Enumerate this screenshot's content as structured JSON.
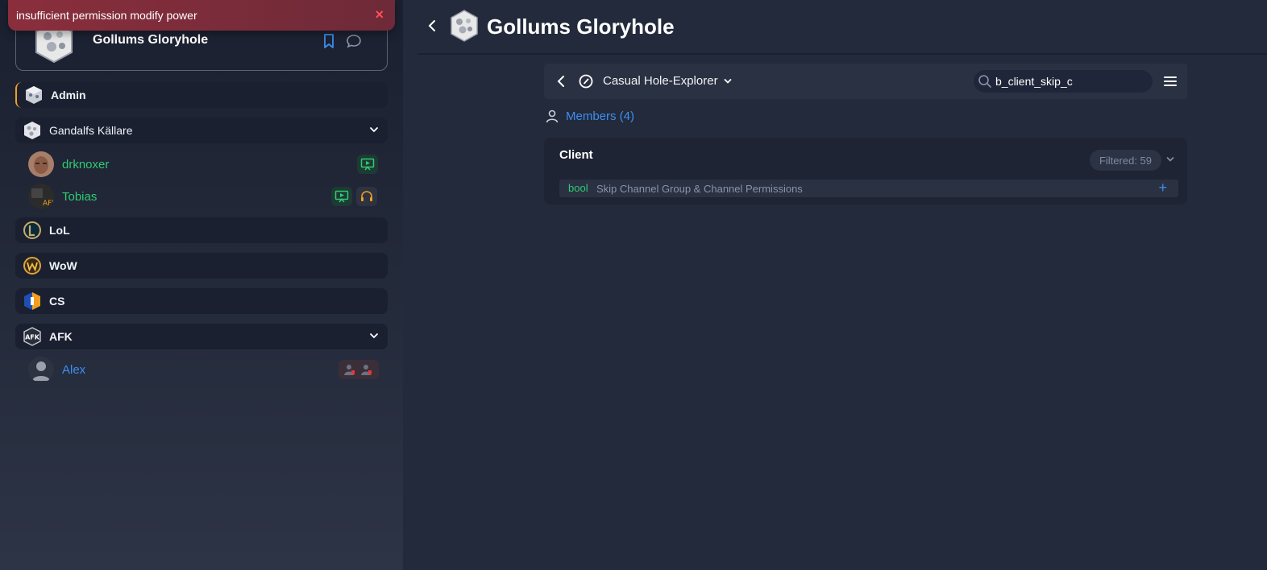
{
  "toast": {
    "message": "insufficient permission modify power",
    "close": "×"
  },
  "server": {
    "name": "Gollums Gloryhole"
  },
  "channels": [
    {
      "label": "Admin"
    },
    {
      "label": "Gandalfs Källare"
    },
    {
      "label": "LoL"
    },
    {
      "label": "WoW"
    },
    {
      "label": "CS"
    },
    {
      "label": "AFK"
    }
  ],
  "members": [
    {
      "name": "drknoxer",
      "color": "#2ecc71"
    },
    {
      "name": "Tobias",
      "color": "#2ecc71",
      "avatar_text": "AFK"
    },
    {
      "name": "Alex",
      "color": "#3d8ef0"
    }
  ],
  "main": {
    "title": "Gollums Gloryhole",
    "group_name": "Casual Hole-Explorer",
    "search_value": "b_client_skip_c",
    "members_link": "Members (4)",
    "panel": {
      "title": "Client",
      "filter_label": "Filtered: 59",
      "permission": {
        "type": "bool",
        "name": "Skip Channel Group & Channel Permissions",
        "add": "+"
      }
    }
  },
  "colors": {
    "accent": "#3d8ef0",
    "green": "#2ecc71",
    "toast": "#8a2e3c"
  }
}
